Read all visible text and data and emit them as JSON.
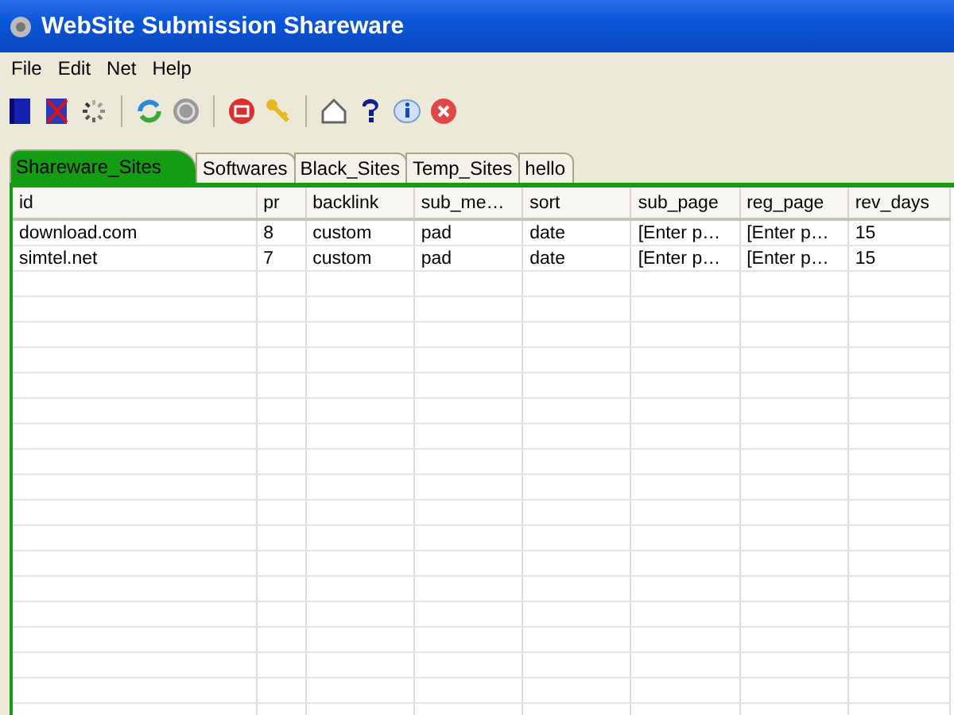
{
  "window": {
    "title": "WebSite Submission Shareware"
  },
  "menu": [
    "File",
    "Edit",
    "Net",
    "Help"
  ],
  "tabs": [
    {
      "label": "Shareware_Sites",
      "selected": true
    },
    {
      "label": "Softwares",
      "selected": false
    },
    {
      "label": "Black_Sites",
      "selected": false
    },
    {
      "label": "Temp_Sites",
      "selected": false
    },
    {
      "label": "hello",
      "selected": false
    }
  ],
  "table": {
    "columns": [
      "id",
      "pr",
      "backlink",
      "sub_me…",
      "sort",
      "sub_page",
      "reg_page",
      "rev_days"
    ],
    "rows": [
      [
        "download.com",
        "8",
        "custom",
        "pad",
        "date",
        "[Enter p…",
        "[Enter p…",
        "15"
      ],
      [
        "simtel.net",
        "7",
        "custom",
        "pad",
        "date",
        "[Enter p…",
        "[Enter p…",
        "15"
      ]
    ]
  }
}
